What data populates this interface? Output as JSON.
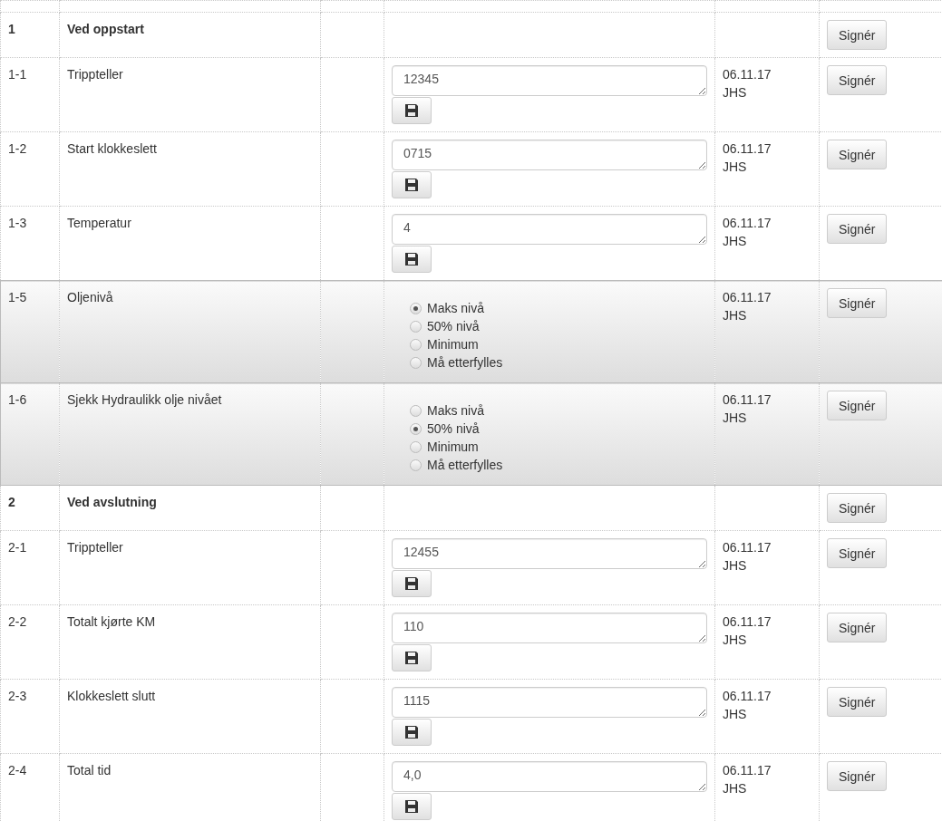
{
  "rows": [
    {
      "kind": "section",
      "number": "1",
      "label": "Ved oppstart",
      "button": "Signér"
    },
    {
      "kind": "input",
      "number": "1-1",
      "label": "Trippteller",
      "value": "12345",
      "date": "06.11.17",
      "initials": "JHS",
      "button": "Signér"
    },
    {
      "kind": "input",
      "number": "1-2",
      "label": "Start klokkeslett",
      "value": "0715",
      "date": "06.11.17",
      "initials": "JHS",
      "button": "Signér"
    },
    {
      "kind": "input",
      "number": "1-3",
      "label": "Temperatur",
      "value": "4",
      "date": "06.11.17",
      "initials": "JHS",
      "button": "Signér"
    },
    {
      "kind": "radio",
      "number": "1-5",
      "label": "Oljenivå",
      "options": [
        {
          "label": "Maks nivå",
          "selected": true
        },
        {
          "label": "50% nivå",
          "selected": false
        },
        {
          "label": "Minimum",
          "selected": false
        },
        {
          "label": "Må etterfylles",
          "selected": false
        }
      ],
      "date": "06.11.17",
      "initials": "JHS",
      "button": "Signér"
    },
    {
      "kind": "radio",
      "number": "1-6",
      "label": "Sjekk Hydraulikk olje nivået",
      "options": [
        {
          "label": "Maks nivå",
          "selected": false
        },
        {
          "label": "50% nivå",
          "selected": true
        },
        {
          "label": "Minimum",
          "selected": false
        },
        {
          "label": "Må etterfylles",
          "selected": false
        }
      ],
      "date": "06.11.17",
      "initials": "JHS",
      "button": "Signér"
    },
    {
      "kind": "section",
      "number": "2",
      "label": "Ved avslutning",
      "button": "Signér"
    },
    {
      "kind": "input",
      "number": "2-1",
      "label": "Trippteller",
      "value": "12455",
      "date": "06.11.17",
      "initials": "JHS",
      "button": "Signér"
    },
    {
      "kind": "input",
      "number": "2-2",
      "label": "Totalt kjørte KM",
      "value": "110",
      "date": "06.11.17",
      "initials": "JHS",
      "button": "Signér"
    },
    {
      "kind": "input",
      "number": "2-3",
      "label": "Klokkeslett slutt",
      "value": "1115",
      "date": "06.11.17",
      "initials": "JHS",
      "button": "Signér"
    },
    {
      "kind": "input",
      "number": "2-4",
      "label": "Total tid",
      "value": "4,0",
      "date": "06.11.17",
      "initials": "JHS",
      "button": "Signér"
    }
  ]
}
